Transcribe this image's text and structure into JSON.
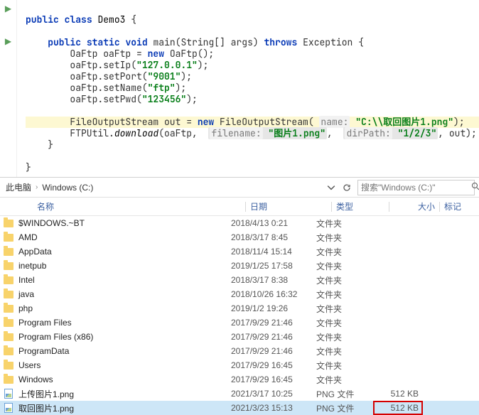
{
  "code": {
    "l1_kw1": "public",
    "l1_kw2": "class",
    "l1_cls": "Demo3",
    "l1_brace": " {",
    "l3_kw1": "public",
    "l3_kw2": "static",
    "l3_kw3": "void",
    "l3_m": "main",
    "l3_args": "(String[] args) ",
    "l3_kw4": "throws",
    "l3_exc": " Exception {",
    "l4_a": "OaFtp oaFtp = ",
    "l4_kw": "new",
    "l4_b": " OaFtp();",
    "l5_a": "oaFtp.setIp(",
    "l5_s": "\"127.0.0.1\"",
    "l5_b": ");",
    "l6_a": "oaFtp.setPort(",
    "l6_s": "\"9001\"",
    "l6_b": ");",
    "l7_a": "oaFtp.setName(",
    "l7_s": "\"ftp\"",
    "l7_b": ");",
    "l8_a": "oaFtp.setPwd(",
    "l8_s": "\"123456\"",
    "l8_b": ");",
    "l10_a": "FileOutputStream out = ",
    "l10_kw": "new",
    "l10_b": " FileOutputStream( ",
    "l10_p": "name:",
    "l10_s": " \"C:\\\\取回图片1.png\"",
    "l10_c": ");",
    "l11_a": "FTPUtil.",
    "l11_m": "download",
    "l11_b": "(oaFtp,  ",
    "l11_p1": "filename:",
    "l11_s1": " \"图片1.png\"",
    "l11_c": ",  ",
    "l11_p2": "dirPath:",
    "l11_s2": " \"1/2/3\"",
    "l11_d": ", out);",
    "l12": "}",
    "l14": "}"
  },
  "explorer": {
    "crumb1": "此电脑",
    "crumb2": "Windows (C:)",
    "search_placeholder": "搜索\"Windows (C:)\"",
    "headers": {
      "name": "名称",
      "date": "日期",
      "type": "类型",
      "size": "大小",
      "tag": "标记"
    },
    "rows": [
      {
        "icon": "folder",
        "name": "$WINDOWS.~BT",
        "date": "2018/4/13 0:21",
        "type": "文件夹",
        "size": ""
      },
      {
        "icon": "folder",
        "name": "AMD",
        "date": "2018/3/17 8:45",
        "type": "文件夹",
        "size": ""
      },
      {
        "icon": "folder",
        "name": "AppData",
        "date": "2018/11/4 15:14",
        "type": "文件夹",
        "size": ""
      },
      {
        "icon": "folder",
        "name": "inetpub",
        "date": "2019/1/25 17:58",
        "type": "文件夹",
        "size": ""
      },
      {
        "icon": "folder",
        "name": "Intel",
        "date": "2018/3/17 8:38",
        "type": "文件夹",
        "size": ""
      },
      {
        "icon": "folder",
        "name": "java",
        "date": "2018/10/26 16:32",
        "type": "文件夹",
        "size": ""
      },
      {
        "icon": "folder",
        "name": "php",
        "date": "2019/1/2 19:26",
        "type": "文件夹",
        "size": ""
      },
      {
        "icon": "folder",
        "name": "Program Files",
        "date": "2017/9/29 21:46",
        "type": "文件夹",
        "size": ""
      },
      {
        "icon": "folder",
        "name": "Program Files (x86)",
        "date": "2017/9/29 21:46",
        "type": "文件夹",
        "size": ""
      },
      {
        "icon": "folder",
        "name": "ProgramData",
        "date": "2017/9/29 21:46",
        "type": "文件夹",
        "size": ""
      },
      {
        "icon": "folder",
        "name": "Users",
        "date": "2017/9/29 16:45",
        "type": "文件夹",
        "size": ""
      },
      {
        "icon": "folder",
        "name": "Windows",
        "date": "2017/9/29 16:45",
        "type": "文件夹",
        "size": ""
      },
      {
        "icon": "png",
        "name": "上传图片1.png",
        "date": "2021/3/17 10:25",
        "type": "PNG 文件",
        "size": "512 KB"
      },
      {
        "icon": "png",
        "name": "取回图片1.png",
        "date": "2021/3/23 15:13",
        "type": "PNG 文件",
        "size": "512 KB",
        "selected": true,
        "redbox": true
      }
    ]
  }
}
